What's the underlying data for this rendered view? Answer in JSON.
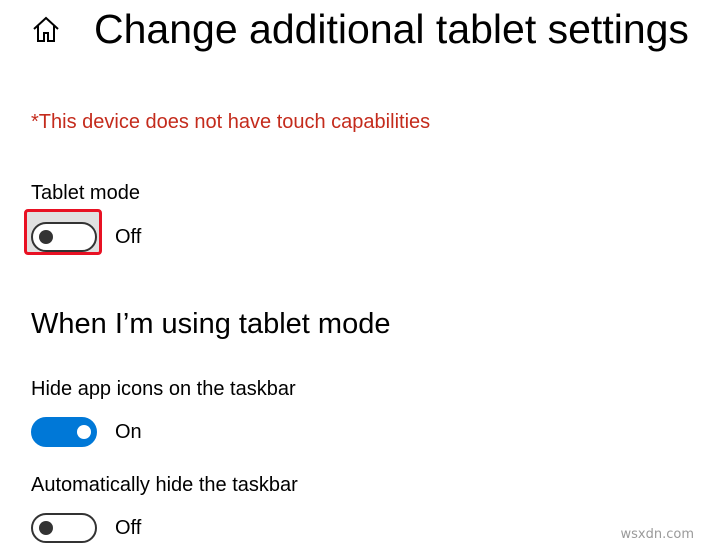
{
  "header": {
    "home_icon": "home-icon",
    "title": "Change additional tablet settings"
  },
  "warning": "*This device does not have touch capabilities",
  "tablet_mode": {
    "label": "Tablet mode",
    "state": "Off",
    "on": false
  },
  "section": {
    "heading": "When I’m using tablet mode"
  },
  "hide_app_icons": {
    "label": "Hide app icons on the taskbar",
    "state": "On",
    "on": true
  },
  "auto_hide_taskbar": {
    "label": "Automatically hide the taskbar",
    "state": "Off",
    "on": false
  },
  "watermark": "wsxdn.com",
  "colors": {
    "accent": "#0078d7",
    "warning": "#c42b1c",
    "highlight": "#e81123"
  }
}
